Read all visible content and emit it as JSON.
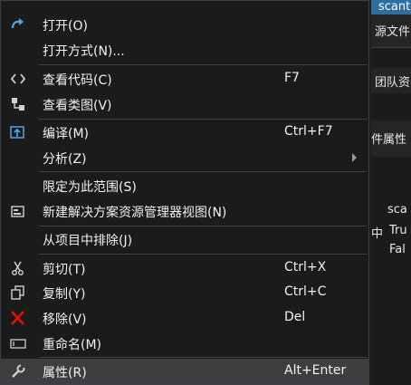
{
  "background": {
    "tab_title": "scant",
    "fragments": [
      "源文件",
      "团队资",
      "件属性"
    ],
    "grid": [
      [
        "sca"
      ],
      [
        "中",
        "Tru"
      ],
      [
        "Fal"
      ]
    ]
  },
  "menu": {
    "items": [
      {
        "label": "打开(O)",
        "shortcut": "",
        "icon": "redo-arrow-icon"
      },
      {
        "label": "打开方式(N)...",
        "shortcut": "",
        "icon": ""
      },
      {
        "label": "查看代码(C)",
        "shortcut": "F7",
        "icon": "code-brackets-icon"
      },
      {
        "label": "查看类图(V)",
        "shortcut": "",
        "icon": "class-diagram-icon"
      },
      {
        "label": "编译(M)",
        "shortcut": "Ctrl+F7",
        "icon": "compile-icon"
      },
      {
        "label": "分析(Z)",
        "shortcut": "",
        "icon": ""
      },
      {
        "label": "限定为此范围(S)",
        "shortcut": "",
        "icon": ""
      },
      {
        "label": "新建解决方案资源管理器视图(N)",
        "shortcut": "",
        "icon": "new-view-icon"
      },
      {
        "label": "从项目中排除(J)",
        "shortcut": "",
        "icon": ""
      },
      {
        "label": "剪切(T)",
        "shortcut": "Ctrl+X",
        "icon": "scissors-icon"
      },
      {
        "label": "复制(Y)",
        "shortcut": "Ctrl+C",
        "icon": "copy-icon"
      },
      {
        "label": "移除(V)",
        "shortcut": "Del",
        "icon": "remove-x-icon"
      },
      {
        "label": "重命名(M)",
        "shortcut": "",
        "icon": "rename-icon"
      },
      {
        "label": "属性(R)",
        "shortcut": "Alt+Enter",
        "icon": "wrench-icon"
      }
    ],
    "colors": {
      "background": "#1b1b1c",
      "hover": "#3e3e40",
      "remove_icon": "#e51400"
    }
  }
}
